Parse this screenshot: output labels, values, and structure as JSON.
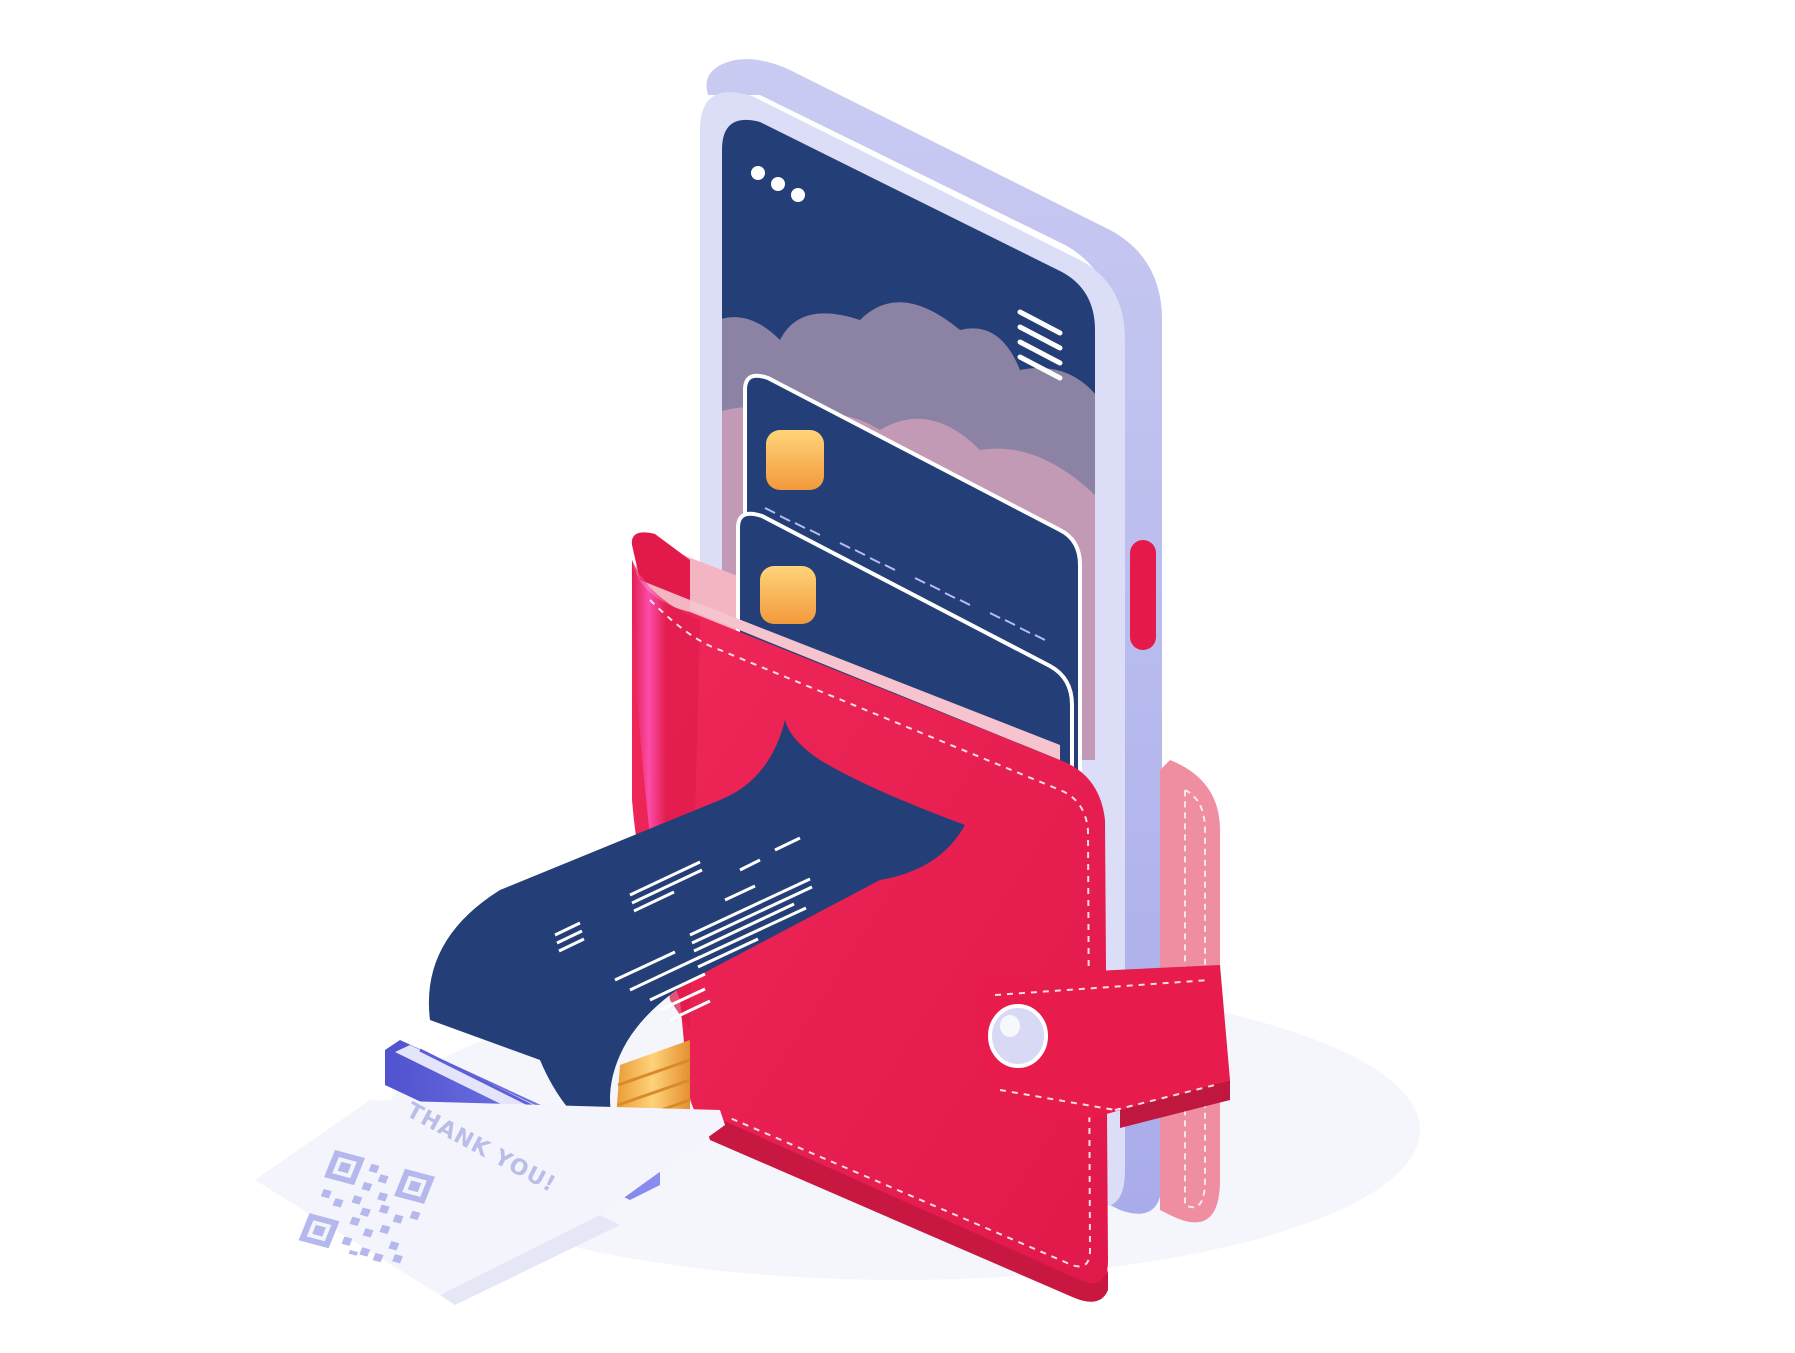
{
  "illustration": {
    "receipt_text": "THANK YOU!",
    "icons": [
      "phone",
      "wallet",
      "credit-card",
      "credit-card",
      "receipt",
      "coin",
      "qr-code",
      "menu-icon",
      "dots-icon"
    ],
    "colors": {
      "phone_body": "#d6d8f6",
      "phone_screen": "#243f77",
      "cloud_back": "#8c82a3",
      "cloud_front": "#c39ab5",
      "card": "#243f77",
      "chip": "#f7b45a",
      "wallet": "#ea1e4d",
      "wallet_dark": "#c81841",
      "wallet_inner": "#f5a3b4",
      "coin": "#f5b347",
      "receipt_print": "#243f77",
      "slot": "#5d5fd6",
      "button_red": "#e5194a"
    }
  }
}
